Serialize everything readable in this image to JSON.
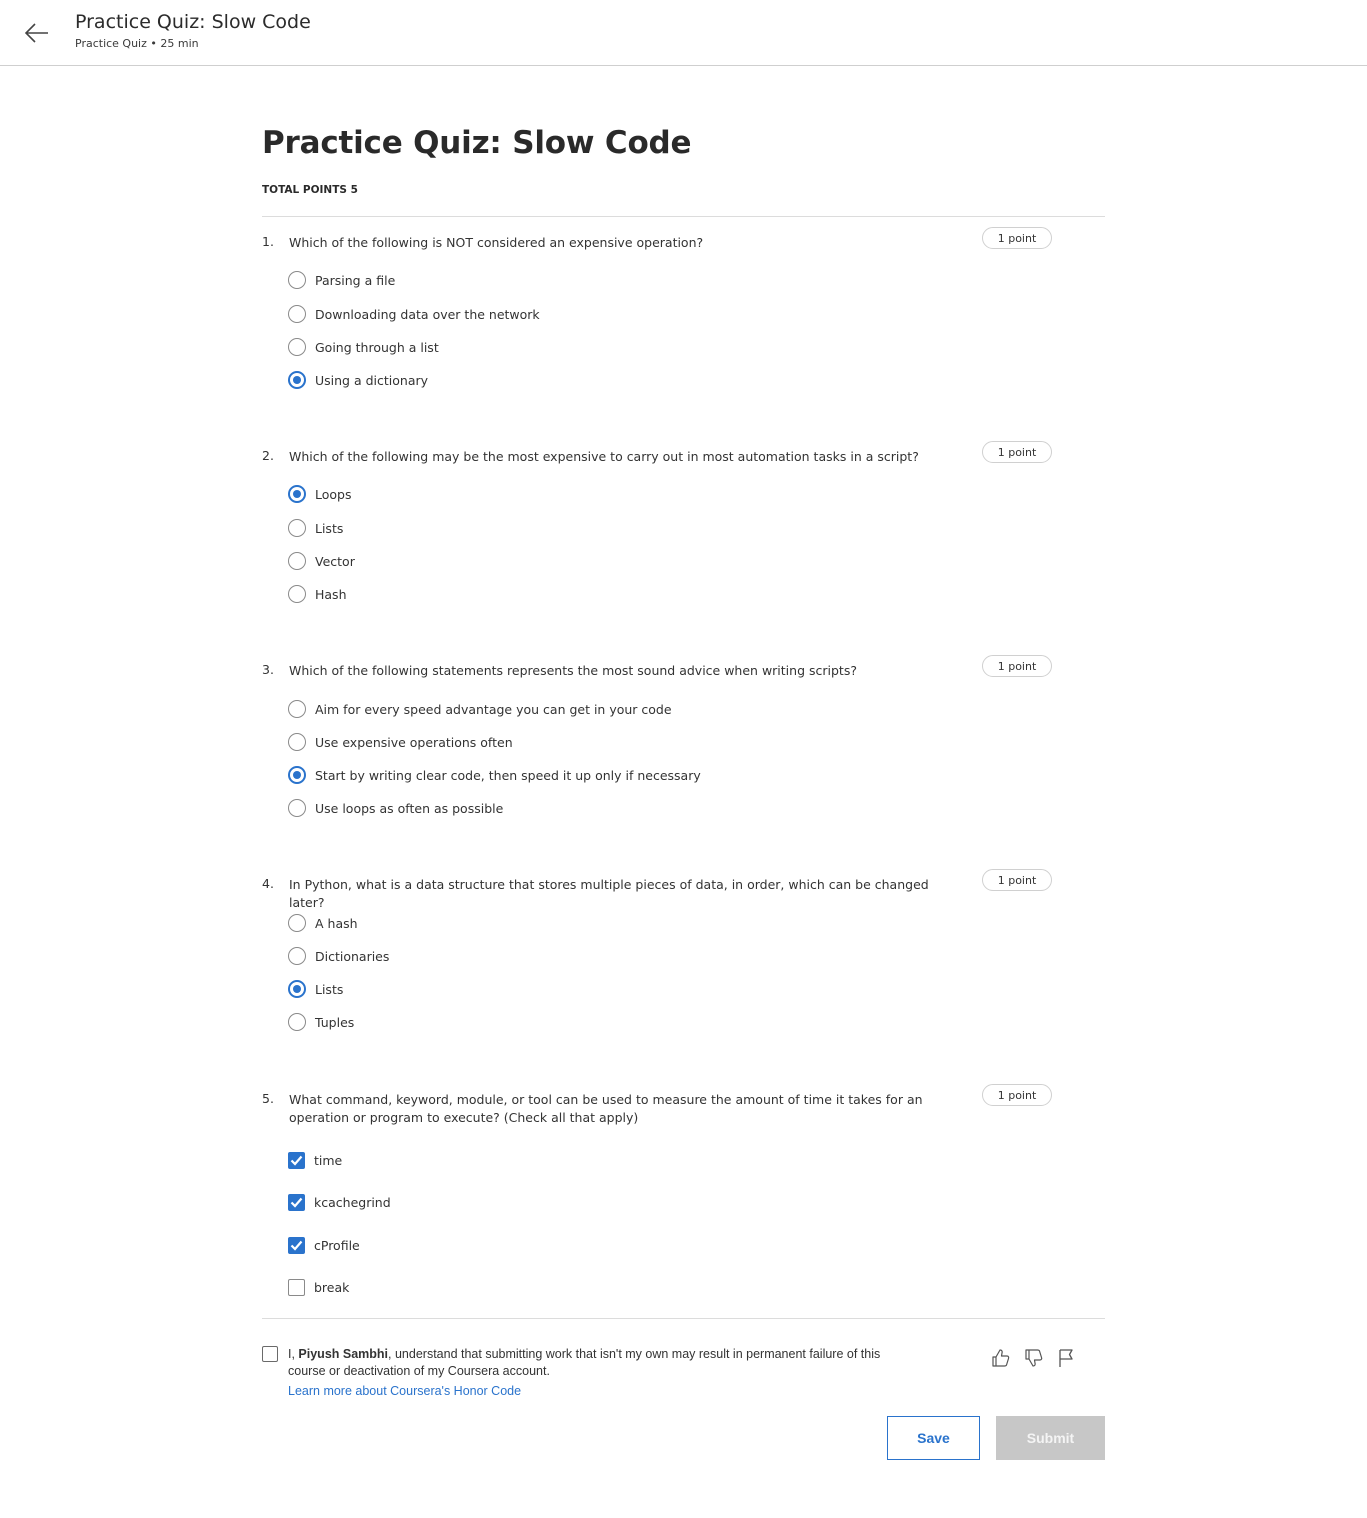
{
  "header": {
    "title": "Practice Quiz: Slow Code",
    "subtitle": "Practice Quiz • 25 min"
  },
  "page": {
    "title": "Practice Quiz: Slow Code",
    "total_points": "TOTAL POINTS 5"
  },
  "accent_color": "#2a73cc",
  "questions": [
    {
      "number": "1.",
      "text": "Which of the following is NOT considered an expensive operation?",
      "points": "1 point",
      "type": "radio",
      "options": [
        {
          "label": "Parsing a file",
          "selected": false
        },
        {
          "label": "Downloading data over the network",
          "selected": false
        },
        {
          "label": "Going through a list",
          "selected": false
        },
        {
          "label": "Using a dictionary",
          "selected": true
        }
      ]
    },
    {
      "number": "2.",
      "text": "Which of the following may be the most expensive to carry out in most automation tasks in a script?",
      "points": "1 point",
      "type": "radio",
      "options": [
        {
          "label": "Loops",
          "selected": true
        },
        {
          "label": "Lists",
          "selected": false
        },
        {
          "label": "Vector",
          "selected": false
        },
        {
          "label": "Hash",
          "selected": false
        }
      ]
    },
    {
      "number": "3.",
      "text": "Which of the following statements represents the most sound advice when writing scripts?",
      "points": "1 point",
      "type": "radio",
      "options": [
        {
          "label": "Aim for every speed advantage you can get in your code",
          "selected": false
        },
        {
          "label": "Use expensive operations often",
          "selected": false
        },
        {
          "label": "Start by writing clear code, then speed it up only if necessary",
          "selected": true
        },
        {
          "label": "Use loops as often as possible",
          "selected": false
        }
      ]
    },
    {
      "number": "4.",
      "text": "In Python, what is a data structure that stores multiple pieces of data, in order, which can be changed later?",
      "points": "1 point",
      "type": "radio",
      "options": [
        {
          "label": "A hash",
          "selected": false
        },
        {
          "label": "Dictionaries",
          "selected": false
        },
        {
          "label": "Lists",
          "selected": true
        },
        {
          "label": "Tuples",
          "selected": false
        }
      ]
    },
    {
      "number": "5.",
      "text": "What command, keyword, module, or tool can be used to measure the amount of time it takes for an operation or program to execute? (Check all that apply)",
      "points": "1 point",
      "type": "checkbox",
      "options": [
        {
          "label": "time",
          "selected": true
        },
        {
          "label": "kcachegrind",
          "selected": true
        },
        {
          "label": "cProfile",
          "selected": true
        },
        {
          "label": "break",
          "selected": false
        }
      ]
    }
  ],
  "honor": {
    "prefix": "I, ",
    "name": "Piyush Sambhi",
    "suffix": ", understand that submitting work that isn't my own may result in permanent failure of this course or deactivation of my Coursera account.",
    "link": "Learn more about Coursera's Honor Code",
    "checked": false
  },
  "feedback_icons": [
    "thumbs-up-icon",
    "thumbs-down-icon",
    "flag-icon"
  ],
  "actions": {
    "save": "Save",
    "submit": "Submit"
  }
}
